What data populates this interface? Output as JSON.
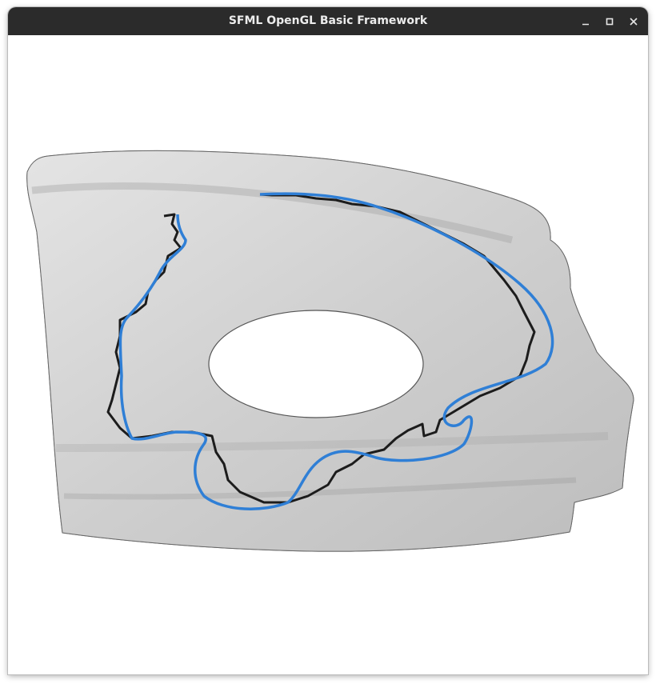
{
  "window": {
    "title": "SFML OpenGL Basic Framework",
    "controls": [
      "minimize-icon",
      "maximize-icon",
      "close-icon"
    ]
  },
  "viewport": {
    "background": "#ffffff",
    "mesh_edge_color": "#7a7a7a",
    "mesh_fill_color": "#d6d6d6",
    "curves": [
      {
        "name": "",
        "color": "#1c1c1c"
      },
      {
        "name": "",
        "color": "#2f7fd6"
      }
    ]
  }
}
